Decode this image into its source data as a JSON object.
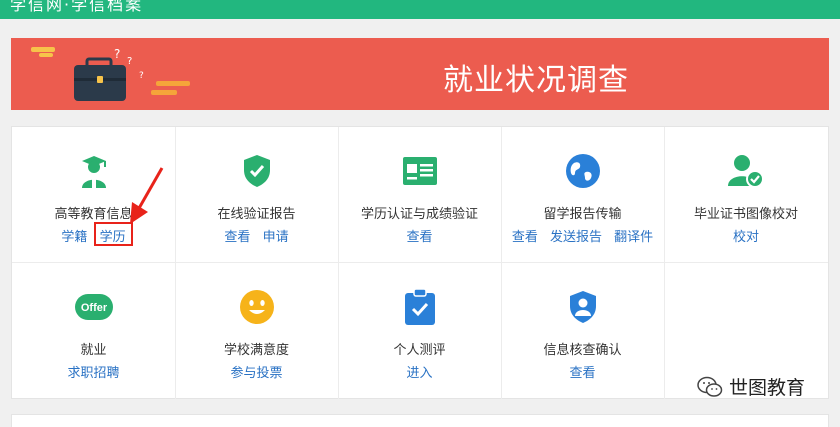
{
  "header": {
    "title": "学信网·学信档案"
  },
  "banner": {
    "title": "就业状况调查"
  },
  "services": [
    {
      "name": "高等教育信息",
      "icon": "graduate-icon",
      "links": [
        "学籍",
        "学历"
      ]
    },
    {
      "name": "在线验证报告",
      "icon": "shield-check-icon",
      "links": [
        "查看",
        "申请"
      ]
    },
    {
      "name": "学历认证与成绩验证",
      "icon": "id-card-icon",
      "links": [
        "查看"
      ]
    },
    {
      "name": "留学报告传输",
      "icon": "globe-icon",
      "links": [
        "查看",
        "发送报告",
        "翻译件"
      ]
    },
    {
      "name": "毕业证书图像校对",
      "icon": "user-check-icon",
      "links": [
        "校对"
      ]
    },
    {
      "name": "就业",
      "icon": "offer-icon",
      "links": [
        "求职招聘"
      ]
    },
    {
      "name": "学校满意度",
      "icon": "smiley-icon",
      "links": [
        "参与投票"
      ]
    },
    {
      "name": "个人测评",
      "icon": "clipboard-check-icon",
      "links": [
        "进入"
      ]
    },
    {
      "name": "信息核查确认",
      "icon": "user-shield-icon",
      "links": [
        "查看"
      ]
    }
  ],
  "offer_badge_text": "Offer",
  "watermark": {
    "text": "世图教育"
  },
  "colors": {
    "topbar": "#22b77f",
    "banner": "#ec5c4f",
    "link": "#2a72c4",
    "icon_green": "#2aaf6f",
    "annotation": "#e8231a"
  }
}
